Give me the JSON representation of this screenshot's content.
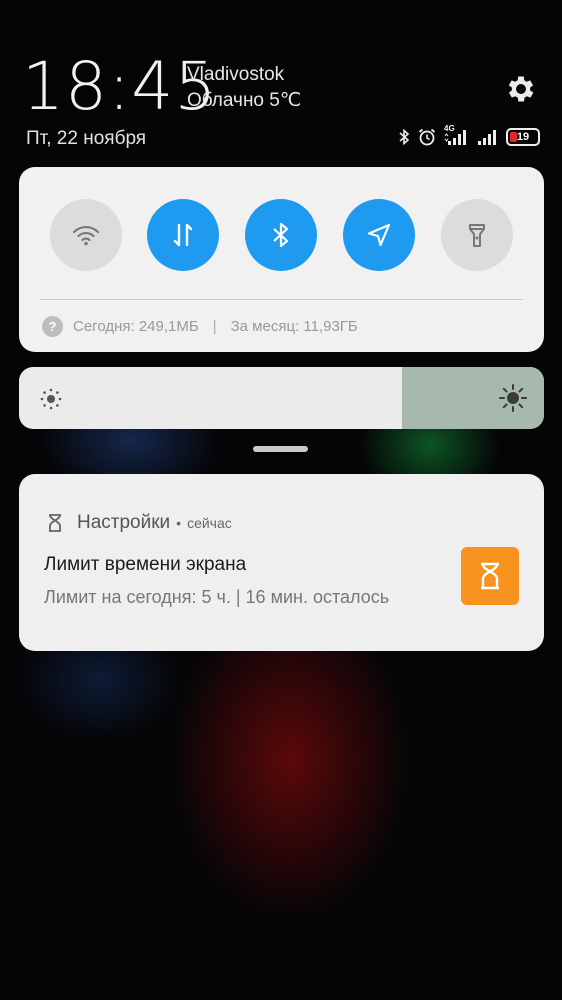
{
  "header": {
    "time": "18:45",
    "city": "Vladivostok",
    "weather": "Облачно 5℃",
    "date": "Пт, 22 ноября",
    "network_label": "4G",
    "battery_level": "19",
    "settings_icon": "gear-icon"
  },
  "quick_settings": {
    "tiles": [
      {
        "name": "wifi",
        "icon": "wifi-icon",
        "state": "off"
      },
      {
        "name": "mobile-data",
        "icon": "data-arrows-icon",
        "state": "on"
      },
      {
        "name": "bluetooth",
        "icon": "bluetooth-icon",
        "state": "on"
      },
      {
        "name": "location",
        "icon": "location-arrow-icon",
        "state": "on"
      },
      {
        "name": "flashlight",
        "icon": "flashlight-icon",
        "state": "off"
      }
    ],
    "usage_today": "Сегодня: 249,1МБ",
    "separator": "|",
    "usage_month": "За месяц: 11,93ГБ",
    "help_glyph": "?"
  },
  "brightness": {
    "level_fraction": 0.73
  },
  "notification": {
    "app_name": "Настройки",
    "dot": "•",
    "time": "сейчас",
    "title": "Лимит времени экрана",
    "text": "Лимит на сегодня: 5 ч.  | 16 мин. осталось",
    "icon": "hourglass-icon",
    "accent": "#f7931e"
  },
  "colors": {
    "tile_on": "#1e9bf0",
    "tile_off": "#dcdcdc",
    "battery_low": "#e8252f"
  }
}
